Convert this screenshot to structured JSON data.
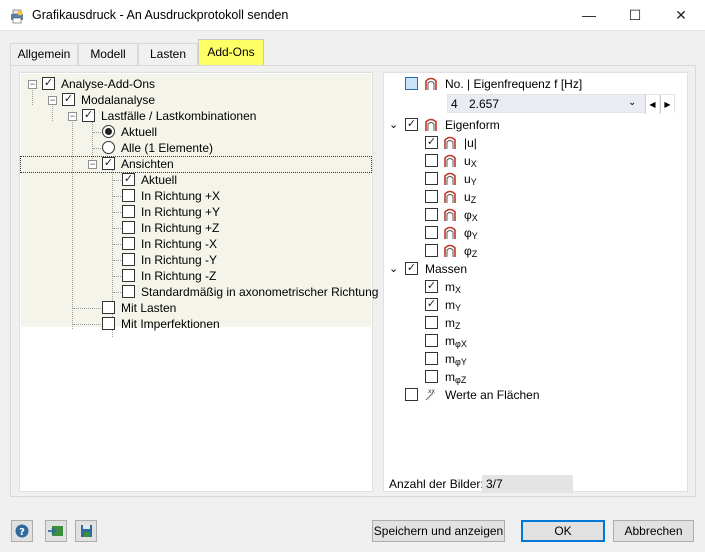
{
  "window": {
    "title": "Grafikausdruck - An Ausdruckprotokoll senden"
  },
  "tabs": [
    "Allgemein",
    "Modell",
    "Lasten",
    "Add-Ons"
  ],
  "active_tab": "Add-Ons",
  "tree": {
    "analysis_addons": "Analyse-Add-Ons",
    "modal_analysis": "Modalanalyse",
    "load_cases": "Lastfälle / Lastkombinationen",
    "current": "Aktuell",
    "all": "Alle (1 Elemente)",
    "views": "Ansichten",
    "view_items": [
      "Aktuell",
      "In Richtung +X",
      "In Richtung +Y",
      "In Richtung +Z",
      "In Richtung -X",
      "In Richtung -Y",
      "In Richtung -Z",
      "Standardmäßig in axonometrischer Richtung"
    ],
    "with_loads": "Mit Lasten",
    "with_imperfections": "Mit Imperfektionen"
  },
  "right": {
    "frequency_label": "No. | Eigenfrequenz f [Hz]",
    "mode_no": "4",
    "frequency_value": "2.657",
    "eigenform_label": "Eigenform",
    "eigenform_items": [
      {
        "main": "|u|",
        "sub": ""
      },
      {
        "main": "u",
        "sub": "X"
      },
      {
        "main": "u",
        "sub": "Y"
      },
      {
        "main": "u",
        "sub": "Z"
      },
      {
        "main": "φ",
        "sub": "X"
      },
      {
        "main": "φ",
        "sub": "Y"
      },
      {
        "main": "φ",
        "sub": "Z"
      }
    ],
    "masses_label": "Massen",
    "mass_items": [
      {
        "main": "m",
        "sub": "X"
      },
      {
        "main": "m",
        "sub": "Y"
      },
      {
        "main": "m",
        "sub": "Z"
      },
      {
        "main": "m",
        "sub": "φX"
      },
      {
        "main": "m",
        "sub": "φY"
      },
      {
        "main": "m",
        "sub": "φZ"
      }
    ],
    "surface_values_label": "Werte an Flächen",
    "count_label": "Anzahl der Bilder:",
    "count_value": "3/7"
  },
  "buttons": {
    "save_show": "Speichern und anzeigen",
    "ok": "OK",
    "cancel": "Abbrechen"
  },
  "colors": {
    "active_tab": "#ffff66",
    "default_border": "#0078d7",
    "mode_icon": "#c0392b"
  },
  "icons": [
    "app-printer-icon",
    "minimize-icon",
    "maximize-icon",
    "close-icon",
    "help-icon",
    "import-icon",
    "save-settings-icon"
  ]
}
